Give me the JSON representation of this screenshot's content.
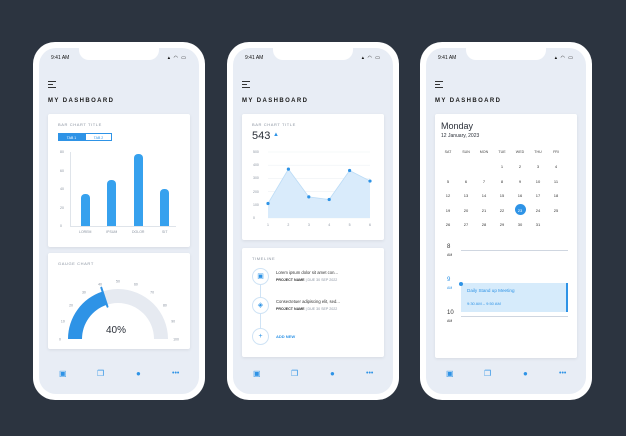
{
  "status": {
    "time": "9:41 AM"
  },
  "dashboard_title": "MY DASHBOARD",
  "phone1": {
    "bar_card": {
      "title": "BAR CHART TITLE",
      "tabs": [
        "TAB 1",
        "TAB 2"
      ],
      "chart_data": {
        "type": "bar",
        "categories": [
          "LOREM",
          "IPSUM",
          "DOLOR",
          "SIT"
        ],
        "values": [
          35,
          50,
          78,
          40
        ],
        "yticks": [
          "80",
          "60",
          "40",
          "20",
          "0"
        ],
        "ylim": [
          0,
          80
        ],
        "color": "#36a1ee"
      }
    },
    "gauge_card": {
      "title": "GAUGE CHART",
      "value_label": "40%",
      "value": 40,
      "ticks": [
        "0",
        "10",
        "20",
        "30",
        "40",
        "50",
        "60",
        "70",
        "80",
        "90",
        "100"
      ]
    }
  },
  "phone2": {
    "line_card": {
      "title": "BAR CHART TITLE",
      "big_value": "543",
      "chart_data": {
        "type": "area",
        "x": [
          "1",
          "2",
          "3",
          "4",
          "5",
          "6"
        ],
        "values": [
          110,
          370,
          160,
          140,
          360,
          280
        ],
        "yticks": [
          "500",
          "400",
          "300",
          "200",
          "100",
          "0"
        ],
        "ylim": [
          0,
          500
        ],
        "color": "#2e93e6"
      }
    },
    "timeline": {
      "title": "TIMELINE",
      "items": [
        {
          "text": "Lorem ipsum dolor sit amet con...",
          "project": "PROJECT NAME",
          "due": "| DUE 30 SEP 2022"
        },
        {
          "text": "Consectetuer adipiscing elit, sed...",
          "project": "PROJECT NAME",
          "due": "| DUE 30 SEP 2022"
        }
      ],
      "add_new": "ADD NEW"
    }
  },
  "phone3": {
    "calendar": {
      "day_name": "Monday",
      "date": "12 January, 2023",
      "weekdays": [
        "SAT",
        "SUN",
        "MON",
        "TUE",
        "WED",
        "THU",
        "FRI"
      ],
      "rows": [
        [
          "",
          "",
          "",
          "1",
          "2",
          "3",
          "4"
        ],
        [
          "5",
          "6",
          "7",
          "8",
          "9",
          "10",
          "11"
        ],
        [
          "12",
          "13",
          "14",
          "15",
          "16",
          "17",
          "18"
        ],
        [
          "19",
          "20",
          "21",
          "22",
          "23",
          "24",
          "25"
        ],
        [
          "26",
          "27",
          "28",
          "29",
          "30",
          "31",
          ""
        ]
      ],
      "cal_rows_real": [
        [
          "",
          "",
          "",
          "",
          "1",
          "2",
          "3"
        ],
        [
          "",
          "",
          "",
          "",
          "",
          "",
          ""
        ]
      ]
    },
    "schedule": {
      "hours": [
        {
          "num": "8",
          "ampm": "AM"
        },
        {
          "num": "9",
          "ampm": "AM"
        },
        {
          "num": "10",
          "ampm": "AM"
        }
      ],
      "event_title": "Daily Stand up Meeting",
      "event_time": "9:30 AM – 9:50 AM"
    }
  }
}
